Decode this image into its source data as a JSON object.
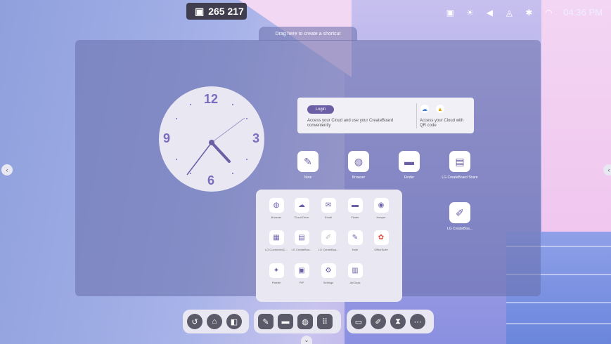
{
  "top": {
    "counter_value": "265 217"
  },
  "status": {
    "time": "04:36 PM"
  },
  "shortcut_bar": {
    "hint": "Drag here to create a shortcut"
  },
  "clock": {
    "numbers": {
      "twelve": "12",
      "three": "3",
      "six": "6",
      "nine": "9"
    }
  },
  "login_card": {
    "login_button": "Login",
    "cloud_text": "Access your Cloud and use your CreateBoard conveniently",
    "qr_text": "Access your Cloud with QR code"
  },
  "desktop_apps": [
    {
      "label": "Note",
      "icon": "note-icon"
    },
    {
      "label": "Browser",
      "icon": "browser-icon"
    },
    {
      "label": "Finder",
      "icon": "finder-icon"
    },
    {
      "label": "LG CreateBoard Share",
      "icon": "share-icon"
    },
    {
      "label": "LG CreateBoa...",
      "icon": "pen-icon"
    }
  ],
  "drawer": {
    "apps": [
      {
        "label": "Browser",
        "icon": "globe-icon"
      },
      {
        "label": "Cloud Drive",
        "icon": "cloud-icon"
      },
      {
        "label": "Email",
        "icon": "mail-icon"
      },
      {
        "label": "Finder",
        "icon": "folder-icon"
      },
      {
        "label": "Keeper",
        "icon": "keeper-icon"
      },
      {
        "label": "LG ConnectedC...",
        "icon": "connected-icon"
      },
      {
        "label": "LG CreateBoa...",
        "icon": "cast-icon"
      },
      {
        "label": "LG CreateBoa...",
        "icon": "pen-icon"
      },
      {
        "label": "Note",
        "icon": "note-icon"
      },
      {
        "label": "OfficeSuite",
        "icon": "office-icon"
      },
      {
        "label": "Palette",
        "icon": "palette-icon"
      },
      {
        "label": "PIP",
        "icon": "pip-icon"
      },
      {
        "label": "Settings",
        "icon": "gear-icon"
      },
      {
        "label": "AirClass",
        "icon": "airclass-icon"
      }
    ]
  },
  "dock": {
    "left": [
      "back-icon",
      "home-icon",
      "split-icon"
    ],
    "middle": [
      "note-icon",
      "finder-icon",
      "browser-icon",
      "apps-grid-icon"
    ],
    "right": [
      "screen-share-icon",
      "pen-icon",
      "timer-icon",
      "more-icon"
    ]
  }
}
